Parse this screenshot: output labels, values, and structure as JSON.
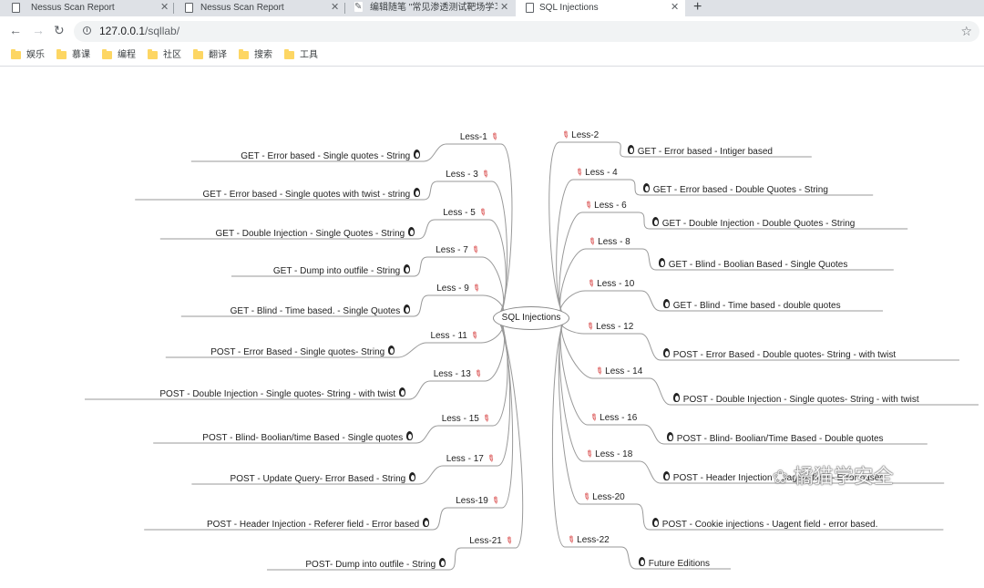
{
  "tabs": [
    {
      "title": "Nessus Scan Report",
      "active": false
    },
    {
      "title": "Nessus Scan Report",
      "active": false
    },
    {
      "title": "编辑随笔 \"常见渗透测试靶场学习",
      "active": false
    },
    {
      "title": "SQL Injections",
      "active": true
    }
  ],
  "address": {
    "host": "127.0.0.1",
    "path": "/sqllab/"
  },
  "bookmarks": [
    "娱乐",
    "慕课",
    "编程",
    "社区",
    "翻译",
    "搜索",
    "工具"
  ],
  "mindmap": {
    "center": "SQL Injections",
    "left": [
      {
        "less": "Less-1",
        "title": "GET - Error based - Single quotes - String"
      },
      {
        "less": "Less - 3",
        "title": "GET - Error based - Single quotes with twist - string"
      },
      {
        "less": "Less - 5",
        "title": "GET - Double Injection - Single Quotes - String"
      },
      {
        "less": "Less - 7",
        "title": "GET - Dump into outfile - String"
      },
      {
        "less": "Less - 9",
        "title": "GET - Blind - Time based. -  Single Quotes"
      },
      {
        "less": "Less - 11",
        "title": "POST - Error Based - Single quotes- String"
      },
      {
        "less": "Less - 13",
        "title": "POST - Double Injection - Single quotes- String - with twist"
      },
      {
        "less": "Less - 15",
        "title": "POST - Blind- Boolian/time Based - Single quotes"
      },
      {
        "less": "Less - 17",
        "title": "POST - Update Query- Error Based - String"
      },
      {
        "less": "Less-19",
        "title": "POST - Header Injection - Referer field - Error based"
      },
      {
        "less": "Less-21",
        "title": "POST- Dump into outfile - String"
      }
    ],
    "right": [
      {
        "less": "Less-2",
        "title": "GET - Error based - Intiger based"
      },
      {
        "less": "Less - 4",
        "title": "GET - Error based - Double Quotes - String"
      },
      {
        "less": "Less - 6",
        "title": "GET - Double Injection - Double Quotes - String"
      },
      {
        "less": "Less - 8",
        "title": "GET - Blind - Boolian Based - Single Quotes"
      },
      {
        "less": "Less - 10",
        "title": "GET - Blind - Time based - double quotes"
      },
      {
        "less": "Less - 12",
        "title": "POST - Error Based - Double quotes- String - with twist"
      },
      {
        "less": "Less - 14",
        "title": "POST - Double Injection - Single quotes- String - with twist"
      },
      {
        "less": "Less - 16",
        "title": "POST - Blind- Boolian/Time Based - Double quotes"
      },
      {
        "less": "Less - 18",
        "title": "POST - Header Injection - Uagent field - Error based"
      },
      {
        "less": "Less-20",
        "title": "POST - Cookie injections - Uagent field - error based."
      },
      {
        "less": "Less-22",
        "title": "Future Editions"
      }
    ]
  },
  "watermark": "橘猫学安全",
  "colors": {
    "pin": "#d32f2f",
    "line": "#999999",
    "folder": "#fdd663"
  }
}
